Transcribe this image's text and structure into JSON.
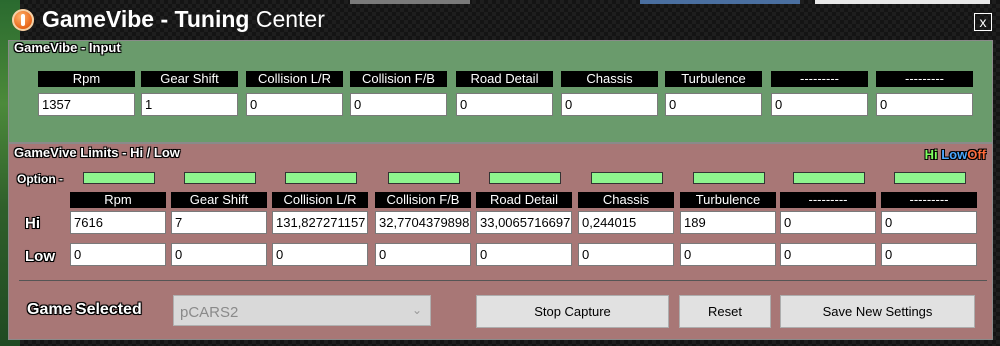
{
  "window": {
    "title_bold": "GameVibe - Tuning",
    "title_rest": " Center",
    "close_glyph": "x",
    "icon": "gamevibe-logo-icon"
  },
  "colors": {
    "input_panel": "#6a9b6c",
    "limits_panel": "#a87776",
    "indicator": "#8ef58e",
    "hi": "#7fff5f",
    "low": "#4aa8ff",
    "off": "#ff6b3a"
  },
  "input": {
    "title": "GameVibe - Input",
    "columns": [
      "Rpm",
      "Gear Shift",
      "Collision L/R",
      "Collision F/B",
      "Road Detail",
      "Chassis",
      "Turbulence",
      "---------",
      "---------"
    ],
    "values": [
      "1357",
      "1",
      "0",
      "0",
      "0",
      "0",
      "0",
      "0",
      "0"
    ]
  },
  "limits": {
    "title": "GameVive Limits - Hi / Low",
    "legend": {
      "hi": "Hi",
      "low": "Low",
      "off": "Off"
    },
    "option_label": "Option -",
    "hi_label": "Hi",
    "low_label": "Low",
    "columns": [
      "Rpm",
      "Gear Shift",
      "Collision L/R",
      "Collision F/B",
      "Road Detail",
      "Chassis",
      "Turbulence",
      "---------",
      "---------"
    ],
    "hi_values": [
      "7616",
      "7",
      "131,827271157",
      "32,7704379898",
      "33,0065716697",
      "0,244015",
      "189",
      "0",
      "0"
    ],
    "low_values": [
      "0",
      "0",
      "0",
      "0",
      "0",
      "0",
      "0",
      "0",
      "0"
    ]
  },
  "footer": {
    "game_label": "Game Selected",
    "game_value": "pCARS2",
    "stop_label": "Stop Capture",
    "reset_label": "Reset",
    "save_label": "Save New Settings"
  }
}
